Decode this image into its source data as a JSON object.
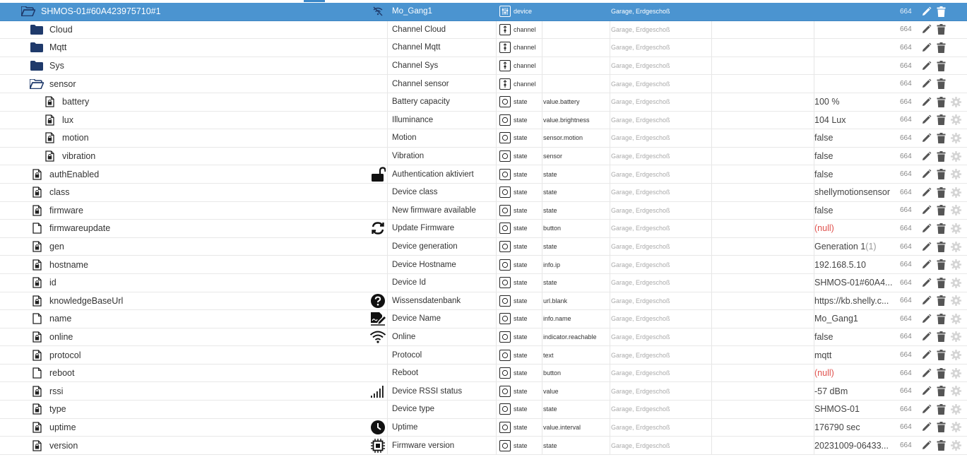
{
  "rows": [
    {
      "name": "SHMOS-01#60A423975710#1",
      "kind": "folder-open",
      "indent": 0,
      "title": "Mo_Gang1",
      "type": "device",
      "type_icon": "device-icon",
      "role": "",
      "room": "Garage, Erdgeschoß",
      "value": "",
      "value_suffix": "",
      "acl": "664",
      "role_icon": "wifi-off-icon",
      "selected": true,
      "gear": false
    },
    {
      "name": "Cloud",
      "kind": "folder",
      "indent": 1,
      "title": "Channel Cloud",
      "type": "channel",
      "type_icon": "channel-icon",
      "role": "",
      "room": "Garage, Erdgeschoß",
      "value": "",
      "value_suffix": "",
      "acl": "664",
      "role_icon": "",
      "gear": false
    },
    {
      "name": "Mqtt",
      "kind": "folder",
      "indent": 1,
      "title": "Channel Mqtt",
      "type": "channel",
      "type_icon": "channel-icon",
      "role": "",
      "room": "Garage, Erdgeschoß",
      "value": "",
      "value_suffix": "",
      "acl": "664",
      "role_icon": "",
      "gear": false
    },
    {
      "name": "Sys",
      "kind": "folder",
      "indent": 1,
      "title": "Channel Sys",
      "type": "channel",
      "type_icon": "channel-icon",
      "role": "",
      "room": "Garage, Erdgeschoß",
      "value": "",
      "value_suffix": "",
      "acl": "664",
      "role_icon": "",
      "gear": false
    },
    {
      "name": "sensor",
      "kind": "folder-open",
      "indent": 1,
      "title": "Channel sensor",
      "type": "channel",
      "type_icon": "channel-icon",
      "role": "",
      "room": "Garage, Erdgeschoß",
      "value": "",
      "value_suffix": "",
      "acl": "664",
      "role_icon": "",
      "gear": false
    },
    {
      "name": "battery",
      "kind": "file-locked",
      "indent": 2,
      "title": "Battery capacity",
      "type": "state",
      "type_icon": "state-icon",
      "role": "value.battery",
      "room": "Garage, Erdgeschoß",
      "value": "100 %",
      "value_suffix": "",
      "acl": "664",
      "role_icon": "",
      "gear": true
    },
    {
      "name": "lux",
      "kind": "file-locked",
      "indent": 2,
      "title": "Illuminance",
      "type": "state",
      "type_icon": "state-icon",
      "role": "value.brightness",
      "room": "Garage, Erdgeschoß",
      "value": "104 Lux",
      "value_suffix": "",
      "acl": "664",
      "role_icon": "",
      "gear": true
    },
    {
      "name": "motion",
      "kind": "file-locked",
      "indent": 2,
      "title": "Motion",
      "type": "state",
      "type_icon": "state-icon",
      "role": "sensor.motion",
      "room": "Garage, Erdgeschoß",
      "value": "false",
      "value_suffix": "",
      "acl": "664",
      "role_icon": "",
      "gear": true
    },
    {
      "name": "vibration",
      "kind": "file-locked",
      "indent": 2,
      "title": "Vibration",
      "type": "state",
      "type_icon": "state-icon",
      "role": "sensor",
      "room": "Garage, Erdgeschoß",
      "value": "false",
      "value_suffix": "",
      "acl": "664",
      "role_icon": "",
      "gear": true
    },
    {
      "name": "authEnabled",
      "kind": "file-locked",
      "indent": 1,
      "title": "Authentication aktiviert",
      "type": "state",
      "type_icon": "state-icon",
      "role": "state",
      "room": "Garage, Erdgeschoß",
      "value": "false",
      "value_suffix": "",
      "acl": "664",
      "role_icon": "unlock-icon",
      "gear": true
    },
    {
      "name": "class",
      "kind": "file-locked",
      "indent": 1,
      "title": "Device class",
      "type": "state",
      "type_icon": "state-icon",
      "role": "state",
      "room": "Garage, Erdgeschoß",
      "value": "shellymotionsensor",
      "value_suffix": "",
      "acl": "664",
      "role_icon": "",
      "gear": true
    },
    {
      "name": "firmware",
      "kind": "file-locked",
      "indent": 1,
      "title": "New firmware available",
      "type": "state",
      "type_icon": "state-icon",
      "role": "state",
      "room": "Garage, Erdgeschoß",
      "value": "false",
      "value_suffix": "",
      "acl": "664",
      "role_icon": "",
      "gear": true
    },
    {
      "name": "firmwareupdate",
      "kind": "file",
      "indent": 1,
      "title": "Update Firmware",
      "type": "state",
      "type_icon": "state-icon",
      "role": "button",
      "room": "Garage, Erdgeschoß",
      "value": "(null)",
      "value_suffix": "",
      "acl": "664",
      "role_icon": "refresh-icon",
      "gear": true,
      "null": true
    },
    {
      "name": "gen",
      "kind": "file-locked",
      "indent": 1,
      "title": "Device generation",
      "type": "state",
      "type_icon": "state-icon",
      "role": "state",
      "room": "Garage, Erdgeschoß",
      "value": "Generation 1",
      "value_suffix": "(1)",
      "acl": "664",
      "role_icon": "",
      "gear": true
    },
    {
      "name": "hostname",
      "kind": "file-locked",
      "indent": 1,
      "title": "Device Hostname",
      "type": "state",
      "type_icon": "state-icon",
      "role": "info.ip",
      "room": "Garage, Erdgeschoß",
      "value": "192.168.5.10",
      "value_suffix": "",
      "acl": "664",
      "role_icon": "",
      "gear": true
    },
    {
      "name": "id",
      "kind": "file-locked",
      "indent": 1,
      "title": "Device Id",
      "type": "state",
      "type_icon": "state-icon",
      "role": "state",
      "room": "Garage, Erdgeschoß",
      "value": "SHMOS-01#60A4...",
      "value_suffix": "",
      "acl": "664",
      "role_icon": "",
      "gear": true
    },
    {
      "name": "knowledgeBaseUrl",
      "kind": "file-locked",
      "indent": 1,
      "title": "Wissensdatenbank",
      "type": "state",
      "type_icon": "state-icon",
      "role": "url.blank",
      "room": "Garage, Erdgeschoß",
      "value": "https://kb.shelly.c...",
      "value_suffix": "",
      "acl": "664",
      "role_icon": "help-icon",
      "gear": true
    },
    {
      "name": "name",
      "kind": "file",
      "indent": 1,
      "title": "Device Name",
      "type": "state",
      "type_icon": "state-icon",
      "role": "info.name",
      "room": "Garage, Erdgeschoß",
      "value": "Mo_Gang1",
      "value_suffix": "",
      "acl": "664",
      "role_icon": "signature-icon",
      "gear": true
    },
    {
      "name": "online",
      "kind": "file-locked",
      "indent": 1,
      "title": "Online",
      "type": "state",
      "type_icon": "state-icon",
      "role": "indicator.reachable",
      "room": "Garage, Erdgeschoß",
      "value": "false",
      "value_suffix": "",
      "acl": "664",
      "role_icon": "wifi-icon",
      "gear": true
    },
    {
      "name": "protocol",
      "kind": "file-locked",
      "indent": 1,
      "title": "Protocol",
      "type": "state",
      "type_icon": "state-icon",
      "role": "text",
      "room": "Garage, Erdgeschoß",
      "value": "mqtt",
      "value_suffix": "",
      "acl": "664",
      "role_icon": "",
      "gear": true
    },
    {
      "name": "reboot",
      "kind": "file",
      "indent": 1,
      "title": "Reboot",
      "type": "state",
      "type_icon": "state-icon",
      "role": "button",
      "room": "Garage, Erdgeschoß",
      "value": "(null)",
      "value_suffix": "",
      "acl": "664",
      "role_icon": "",
      "gear": true,
      "null": true
    },
    {
      "name": "rssi",
      "kind": "file-locked",
      "indent": 1,
      "title": "Device RSSI status",
      "type": "state",
      "type_icon": "state-icon",
      "role": "value",
      "room": "Garage, Erdgeschoß",
      "value": "-57 dBm",
      "value_suffix": "",
      "acl": "664",
      "role_icon": "signal-icon",
      "gear": true
    },
    {
      "name": "type",
      "kind": "file-locked",
      "indent": 1,
      "title": "Device type",
      "type": "state",
      "type_icon": "state-icon",
      "role": "state",
      "room": "Garage, Erdgeschoß",
      "value": "SHMOS-01",
      "value_suffix": "",
      "acl": "664",
      "role_icon": "",
      "gear": true
    },
    {
      "name": "uptime",
      "kind": "file-locked",
      "indent": 1,
      "title": "Uptime",
      "type": "state",
      "type_icon": "state-icon",
      "role": "value.interval",
      "room": "Garage, Erdgeschoß",
      "value": "176790 sec",
      "value_suffix": "",
      "acl": "664",
      "role_icon": "clock-icon",
      "gear": true
    },
    {
      "name": "version",
      "kind": "file-locked",
      "indent": 1,
      "title": "Firmware version",
      "type": "state",
      "type_icon": "state-icon",
      "role": "state",
      "room": "Garage, Erdgeschoß",
      "value": "20231009-06433...",
      "value_suffix": "",
      "acl": "664",
      "role_icon": "chip-icon",
      "gear": true
    }
  ],
  "colors": {
    "selected_bg": "#4b94d0",
    "folder": "#1f3a6b",
    "null_value": "#e0534f"
  }
}
